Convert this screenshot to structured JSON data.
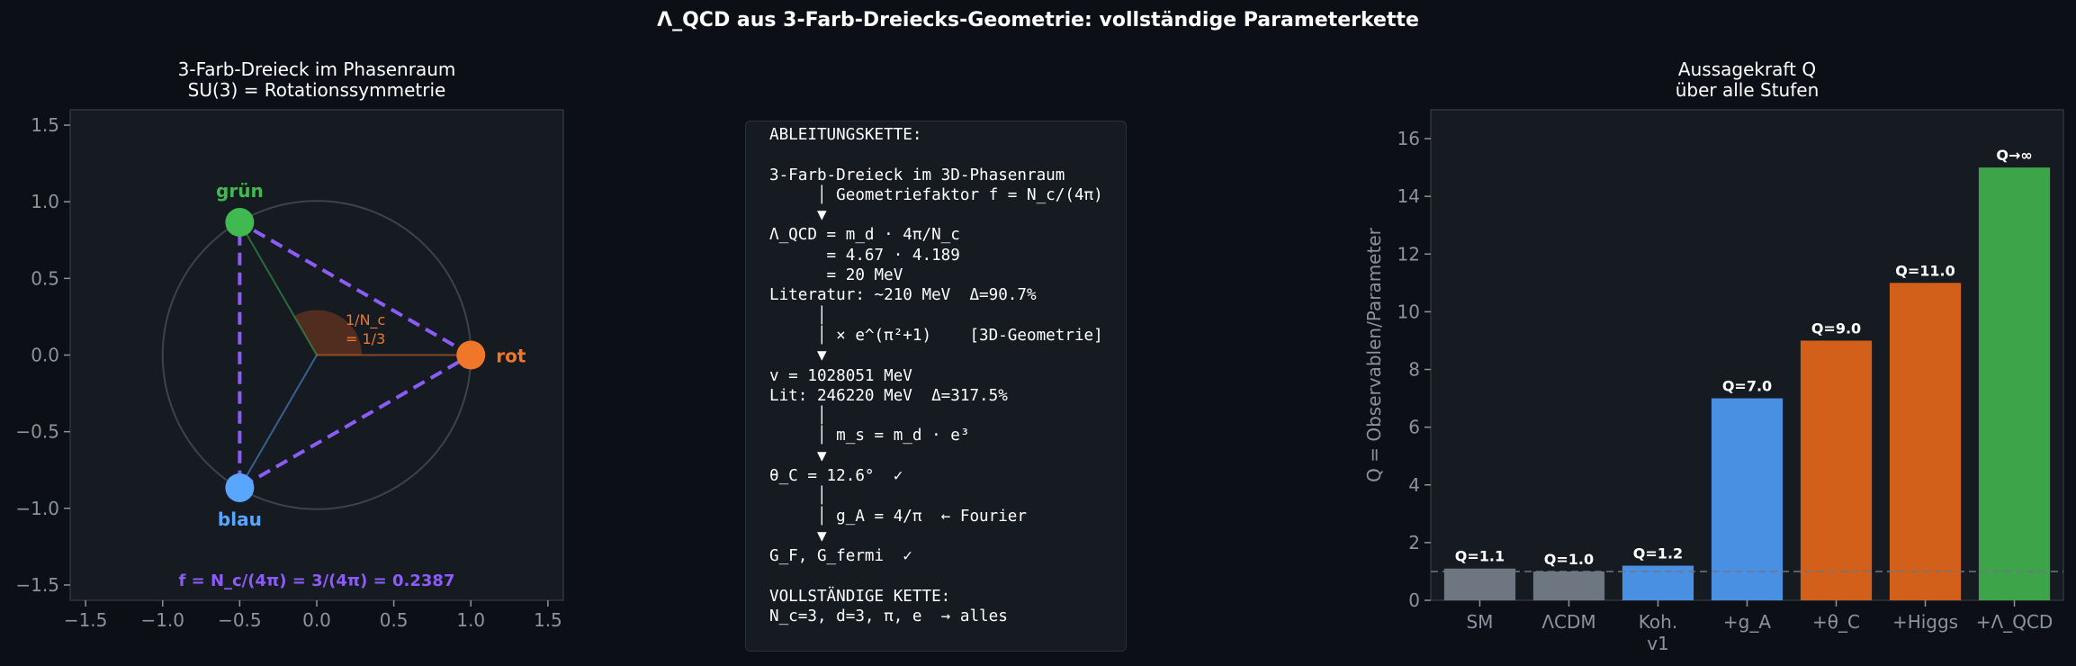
{
  "suptitle": "Λ_QCD aus 3-Farb-Dreiecks-Geometrie: vollständige Parameterkette",
  "colors": {
    "background": "#0c0f16",
    "axes_bg": "#161b22",
    "gruen": "#3fb950",
    "rot": "#f0762a",
    "blau": "#58a6ff",
    "triangle": "#8b5cf6",
    "bar_gray": "#6e7681",
    "bar_blue": "#4a90e2",
    "bar_orange": "#d2601a",
    "bar_green": "#3ea44a"
  },
  "left_plot": {
    "title_line1": "3-Farb-Dreieck im Phasenraum",
    "title_line2": "SU(3) = Rotationssymmetrie",
    "angle_label_line1": "1/N_c",
    "angle_label_line2": "= 1/3",
    "formula": "f = N_c/(4π) = 3/(4π) = 0.2387"
  },
  "middle_box": {
    "lines": [
      "ABLEITUNGSKETTE:",
      "",
      "3-Farb-Dreieck im 3D-Phasenraum",
      "     │ Geometriefaktor f = N_c/(4π)",
      "     ▼",
      "Λ_QCD = m_d · 4π/N_c",
      "      = 4.67 · 4.189",
      "      = 20 MeV",
      "Literatur: ~210 MeV  Δ=90.7%",
      "     │",
      "     │ × e^(π²+1)    [3D-Geometrie]",
      "     ▼",
      "v = 1028051 MeV",
      "Lit: 246220 MeV  Δ=317.5%",
      "     │",
      "     │ m_s = m_d · e³",
      "     ▼",
      "θ_C = 12.6°  ✓",
      "     │",
      "     │ g_A = 4/π  ← Fourier",
      "     ▼",
      "G_F, G_fermi  ✓",
      "",
      "VOLLSTÄNDIGE KETTE:",
      "N_c=3, d=3, π, e  → alles"
    ]
  },
  "right_plot": {
    "title_line1": "Aussagekraft Q",
    "title_line2": "über alle Stufen"
  },
  "chart_data": [
    {
      "type": "scatter",
      "xlim": [
        -1.6,
        1.6
      ],
      "ylim": [
        -1.6,
        1.6
      ],
      "xticks": [
        -1.5,
        -1.0,
        -0.5,
        0.0,
        0.5,
        1.0,
        1.5
      ],
      "yticks": [
        -1.5,
        -1.0,
        -0.5,
        0.0,
        0.5,
        1.0,
        1.5
      ],
      "xtick_labels": [
        "−1.5",
        "−1.0",
        "−0.5",
        "0.0",
        "0.5",
        "1.0",
        "1.5"
      ],
      "ytick_labels": [
        "−1.5",
        "−1.0",
        "−0.5",
        "0.0",
        "0.5",
        "1.0",
        "1.5"
      ],
      "grid": false,
      "circle_radius": 1.0,
      "points": [
        {
          "label": "rot",
          "x": 1.0,
          "y": 0.0,
          "color": "#f0762a"
        },
        {
          "label": "grün",
          "x": -0.5,
          "y": 0.866,
          "color": "#3fb950"
        },
        {
          "label": "blau",
          "x": -0.5,
          "y": -0.866,
          "color": "#58a6ff"
        }
      ]
    },
    {
      "type": "bar",
      "ylabel": "Q = Observablen/Parameter",
      "ylim": [
        0,
        17
      ],
      "yticks": [
        0,
        2,
        4,
        6,
        8,
        10,
        12,
        14,
        16
      ],
      "grid": false,
      "reference_line": 1,
      "categories": [
        {
          "line1": "SM",
          "line2": ""
        },
        {
          "line1": "ΛCDM",
          "line2": ""
        },
        {
          "line1": "Koh.",
          "line2": "v1"
        },
        {
          "line1": "+g_A",
          "line2": ""
        },
        {
          "line1": "+θ_C",
          "line2": ""
        },
        {
          "line1": "+Higgs",
          "line2": ""
        },
        {
          "line1": "+Λ_QCD",
          "line2": ""
        }
      ],
      "values": [
        1.1,
        1.0,
        1.2,
        7.0,
        9.0,
        11.0,
        15.0
      ],
      "data_labels": [
        "Q=1.1",
        "Q=1.0",
        "Q=1.2",
        "Q=7.0",
        "Q=9.0",
        "Q=11.0",
        "Q→∞"
      ],
      "bar_colors": [
        "#6e7681",
        "#6e7681",
        "#4a90e2",
        "#4a90e2",
        "#d2601a",
        "#d2601a",
        "#3ea44a"
      ]
    }
  ]
}
